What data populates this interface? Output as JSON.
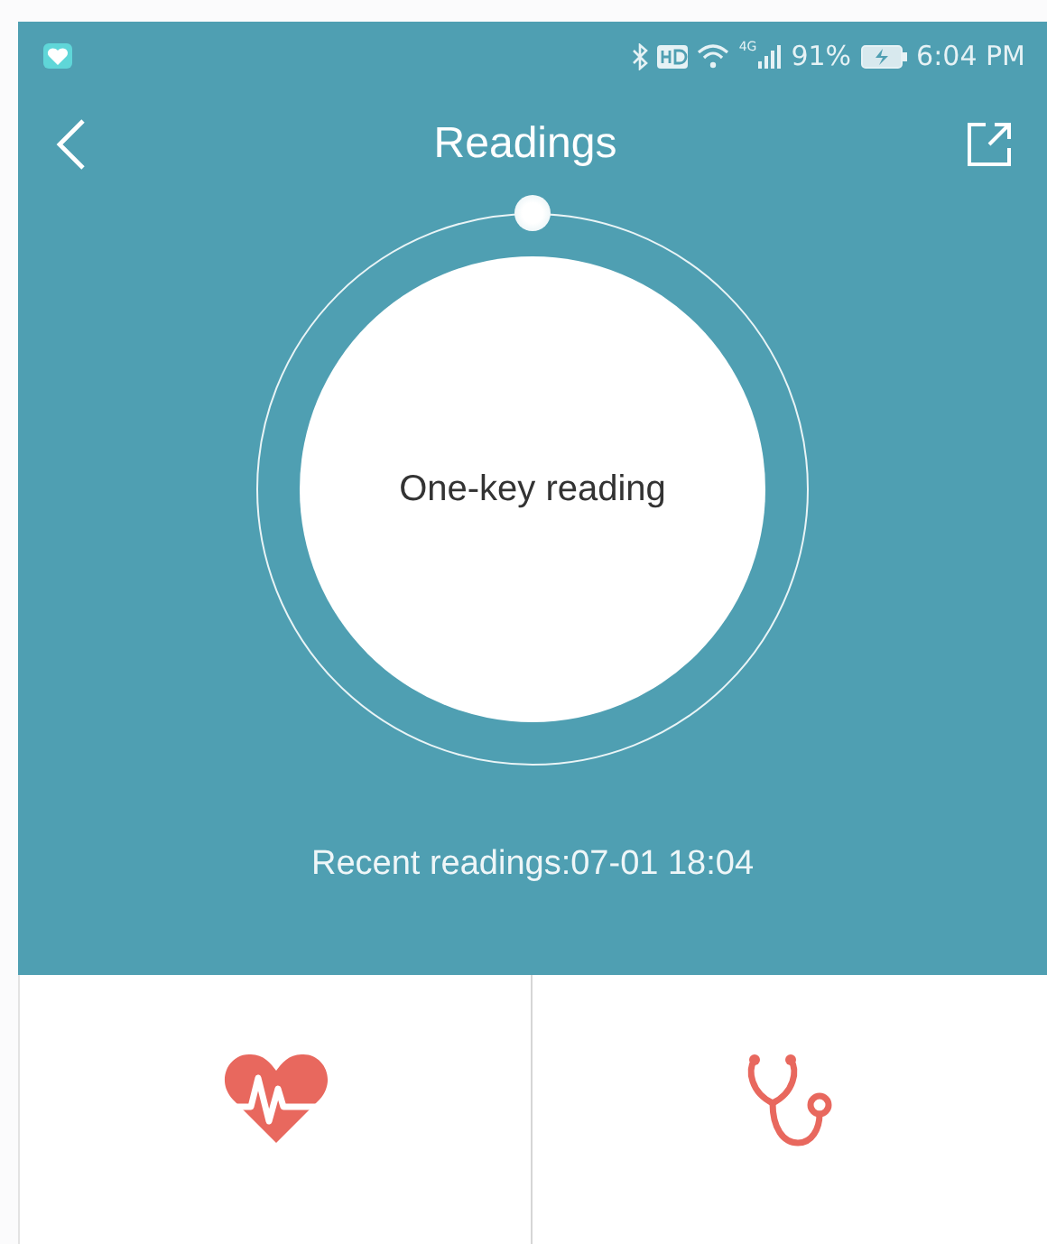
{
  "status_bar": {
    "network": "4G",
    "battery": "91%",
    "time": "6:04 PM"
  },
  "header": {
    "title": "Readings"
  },
  "reading_button": {
    "label": "One-key reading"
  },
  "recent": "Recent readings:07-01 18:04",
  "tiles": [
    {
      "kind": "heart"
    },
    {
      "kind": "stethoscope"
    }
  ]
}
